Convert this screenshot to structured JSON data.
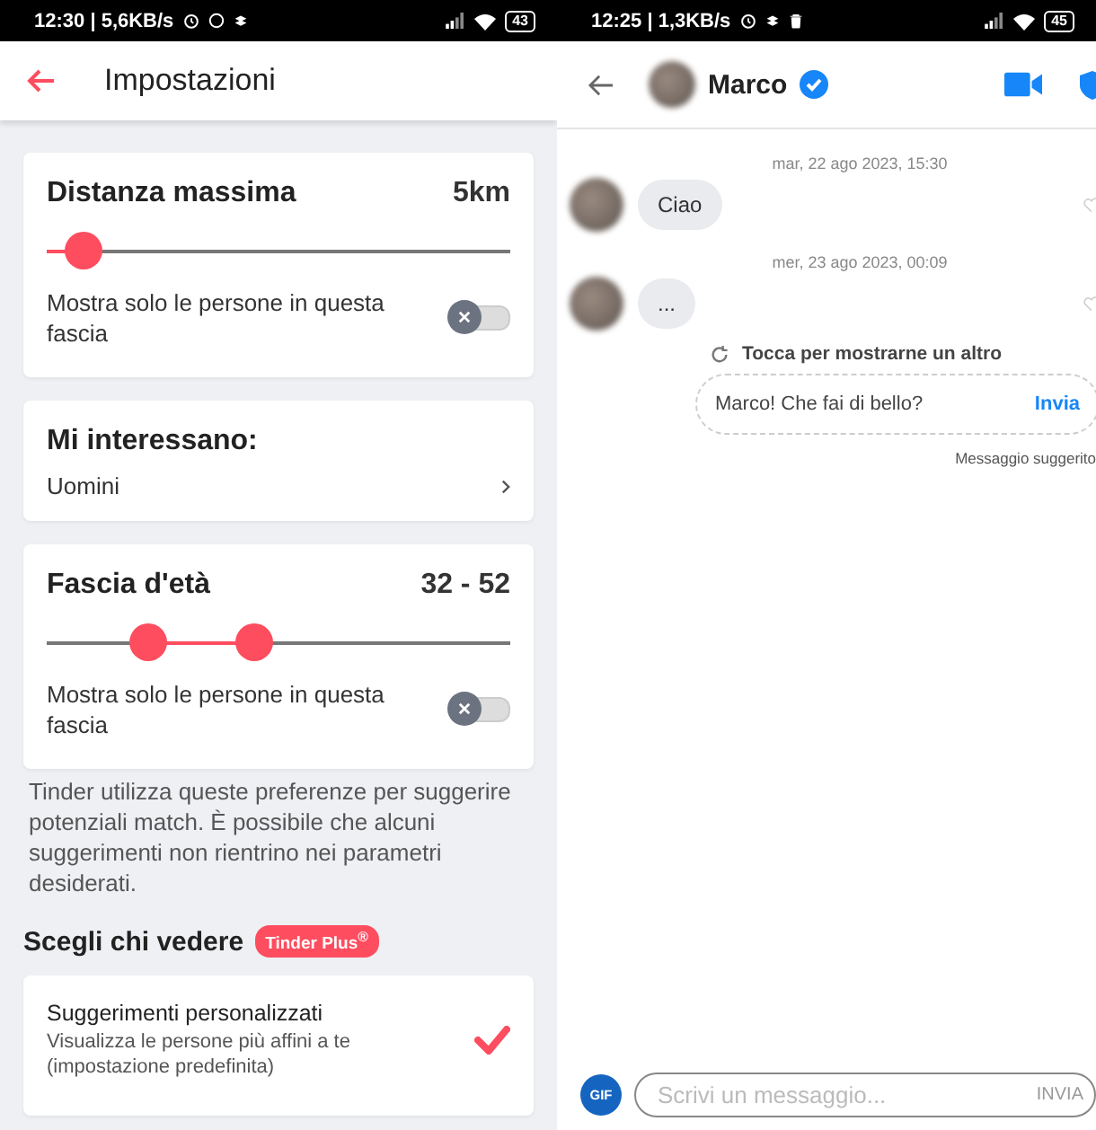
{
  "left": {
    "status_bar": {
      "time": "12:30 | 5,6KB/s",
      "battery": "43"
    },
    "header": {
      "title": "Impostazioni"
    },
    "distance": {
      "title": "Distanza massima",
      "value": "5km",
      "level": 0.05,
      "toggle_label": "Mostra solo le persone in questa fascia",
      "on": false
    },
    "interest": {
      "title": "Mi interessano:",
      "value": "Uomini"
    },
    "age": {
      "title": "Fascia d'età",
      "value": "32 - 52",
      "thumbs": [
        {
          "level": 0.19
        },
        {
          "level": 0.42
        }
      ],
      "toggle_label": "Mostra solo le persone in questa fascia",
      "on": false
    },
    "note": "Tinder utilizza queste preferenze per suggerire potenziali match. È possibile che alcuni suggerimenti non rientrino nei parametri desiderati.",
    "section": {
      "title": "Scegli chi vedere",
      "badge": "Tinder Plus$^{®}$"
    },
    "options": [
      {
        "title": "Suggerimenti personalizzati",
        "description": "Visualizza le persone più affini a te (impostazione predefinita)",
        "checked": true
      }
    ]
  },
  "right": {
    "status_bar": {
      "time": "12:25 | 1,3KB/s",
      "battery": "45"
    },
    "header": {
      "name": "Marco",
      "verified": true
    },
    "messages": [
      {
        "date": "mar, 22 ago 2023, 15:30",
        "text": "Ciao"
      },
      {
        "date": "mer, 23 ago 2023, 00:09",
        "text": "..."
      }
    ],
    "suggestion": {
      "refresh": "Tocca per mostrarne un altro",
      "text": "Marco! Che fai di bello?",
      "action": "Invia",
      "caption": "Messaggio suggerito"
    },
    "composer": {
      "gif": "GIF",
      "placeholder": "Scrivi un messaggio...",
      "send": "INVIA"
    }
  }
}
